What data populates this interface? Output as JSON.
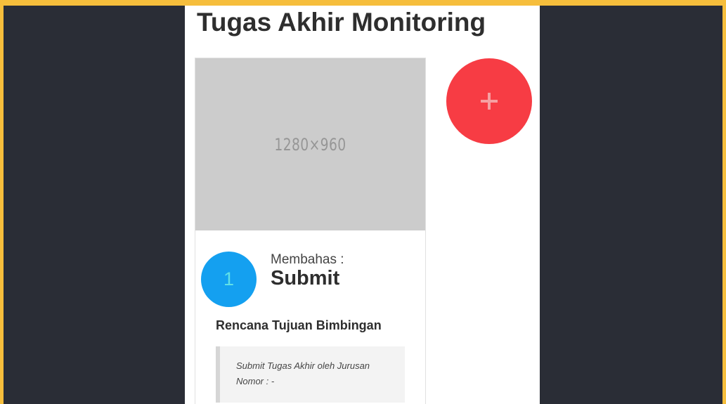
{
  "page": {
    "title": "Tugas Akhir Monitoring"
  },
  "card": {
    "image_placeholder": "1280×960",
    "step_number": "1",
    "topic_label": "Membahas :",
    "topic_value": "Submit",
    "section_heading": "Rencana Tujuan Bimbingan",
    "note_lines": [
      "Submit Tugas Akhir oleh Jurusan",
      "Nomor : -"
    ]
  },
  "add_button": {
    "icon": "plus-icon"
  },
  "colors": {
    "frame_border": "#f6be3c",
    "backdrop": "#2a2d36",
    "page_background": "#ffffff",
    "badge": "#14a0f0",
    "add_button": "#f73c44",
    "image_placeholder": "#cccccc"
  }
}
